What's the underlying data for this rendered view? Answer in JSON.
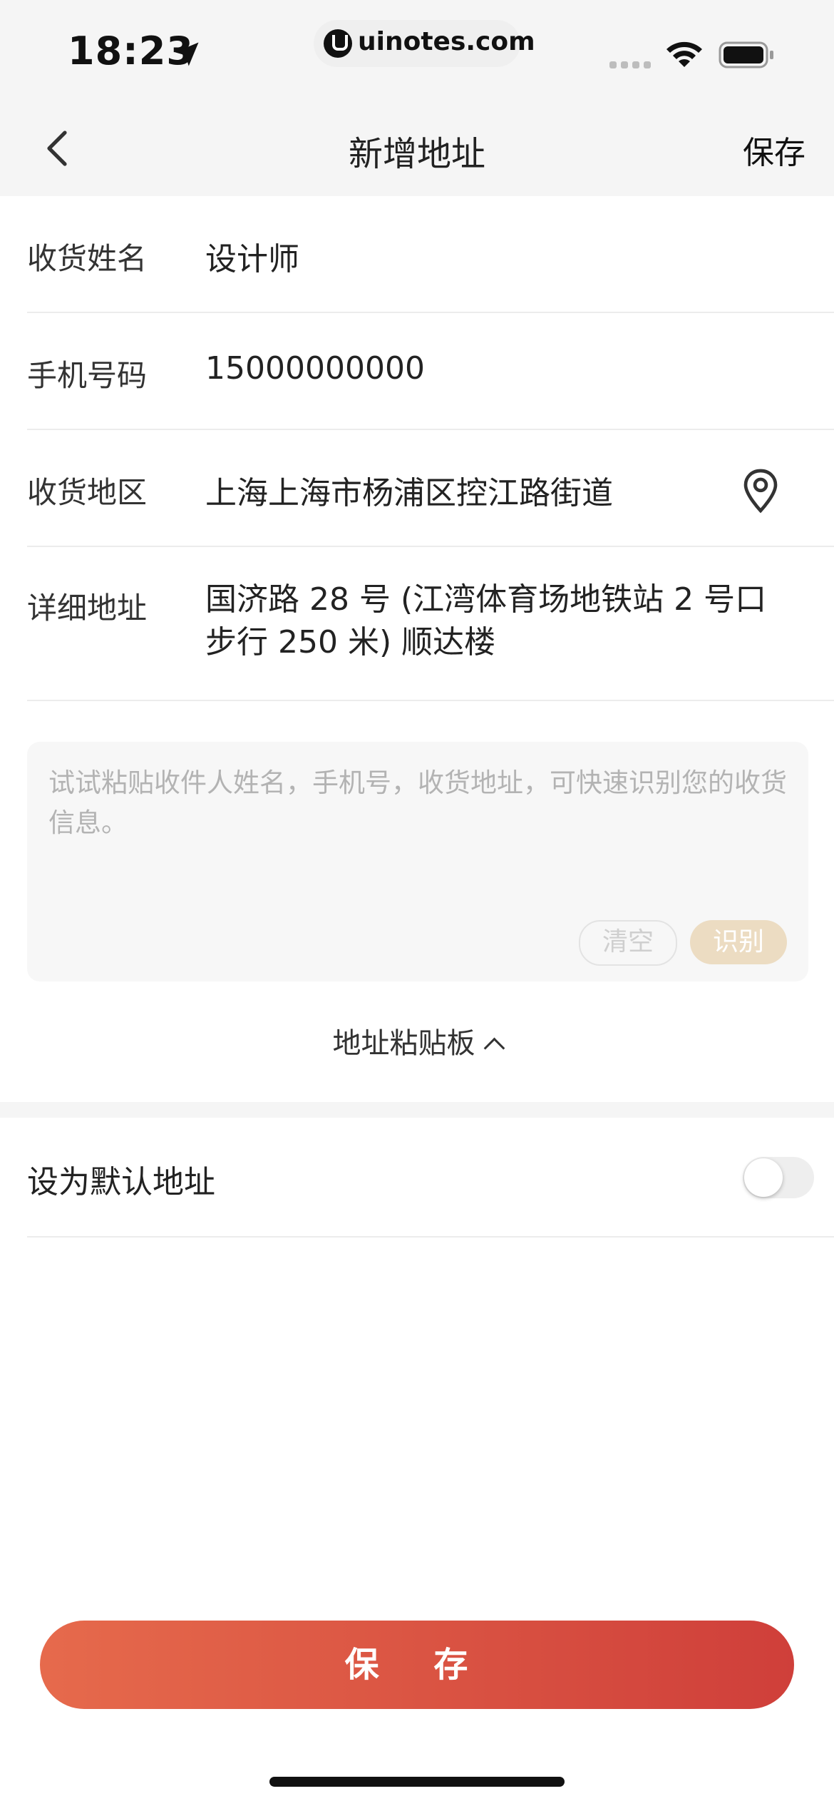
{
  "status_bar": {
    "time": "18:23",
    "url": "uinotes.com",
    "icons": [
      "location-arrow-icon",
      "uinotes-logo-icon",
      "cellular-signal-icon",
      "wifi-icon",
      "battery-icon"
    ]
  },
  "nav": {
    "title": "新增地址",
    "save_label": "保存",
    "back_icon": "chevron-left-icon"
  },
  "form": {
    "name": {
      "label": "收货姓名",
      "value": "设计师"
    },
    "phone": {
      "label": "手机号码",
      "value": "15000000000"
    },
    "region": {
      "label": "收货地区",
      "value": "上海上海市杨浦区控江路街道",
      "icon": "location-pin-icon"
    },
    "detail": {
      "label": "详细地址",
      "value": "国济路 28 号 (江湾体育场地铁站 2 号口步行 250 米) 顺达楼"
    }
  },
  "paste_box": {
    "placeholder": "试试粘贴收件人姓名，手机号，收货地址，可快速识别您的收货信息。",
    "clear_label": "清空",
    "recognize_label": "识别"
  },
  "clipboard_toggle": {
    "label": "地址粘贴板",
    "icon": "chevron-up-icon"
  },
  "default_address": {
    "label": "设为默认地址",
    "enabled": false
  },
  "footer": {
    "save_label": "保 存"
  },
  "colors": {
    "accent_start": "#e66a4c",
    "accent_end": "#cf3f3a",
    "recognize_bg": "#ecdcc2",
    "header_bg": "#f5f5f5"
  }
}
